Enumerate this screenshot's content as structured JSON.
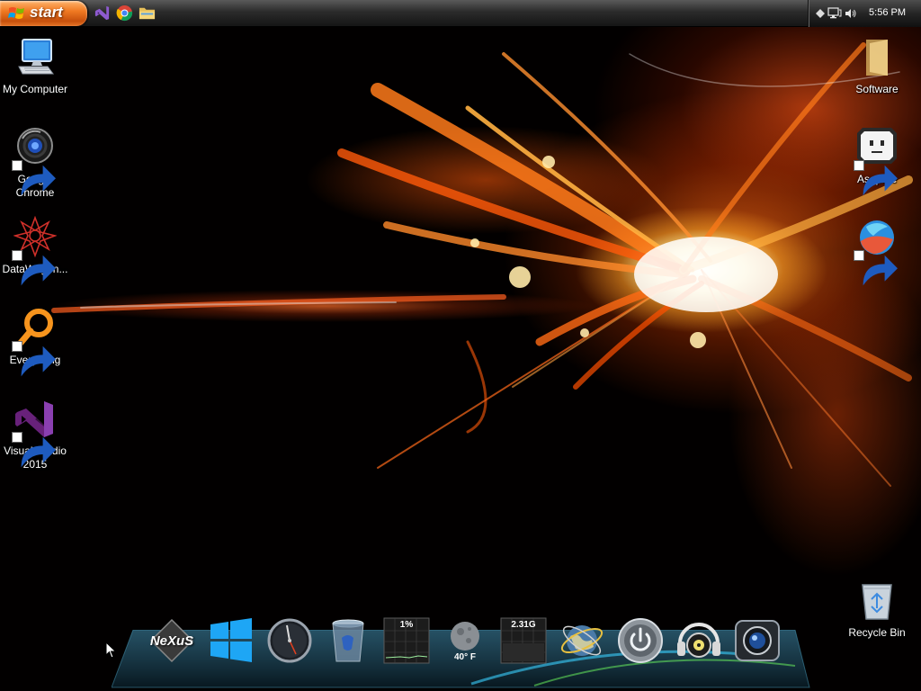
{
  "taskbar": {
    "start_label": "start",
    "quick_launch": [
      {
        "name": "visual-studio-icon"
      },
      {
        "name": "chrome-icon"
      },
      {
        "name": "folder-icon"
      }
    ],
    "tray": {
      "icons": [
        "show-hidden-icon",
        "network-icon",
        "volume-icon"
      ],
      "time": "5:56 PM"
    }
  },
  "desktop": {
    "left_icons": [
      {
        "label": "My Computer",
        "icon": "computer-icon",
        "shortcut": false
      },
      {
        "label": "Google Chrome",
        "icon": "chrome-icon",
        "shortcut": true
      },
      {
        "label": "DataWagon...",
        "icon": "datawagon-icon",
        "shortcut": true
      },
      {
        "label": "Everything",
        "icon": "everything-search-icon",
        "shortcut": true
      },
      {
        "label": "Visual Studio 2015",
        "icon": "visual-studio-icon",
        "shortcut": true
      }
    ],
    "right_icons": [
      {
        "label": "Software",
        "icon": "folder-icon",
        "shortcut": false
      },
      {
        "label": "Aseprite",
        "icon": "aseprite-icon",
        "shortcut": true
      },
      {
        "label": "",
        "icon": "browser-icon",
        "shortcut": true
      },
      {
        "label": "Recycle Bin",
        "icon": "recycle-bin-icon",
        "shortcut": false
      }
    ]
  },
  "dock": {
    "items": [
      {
        "name": "nexus-logo",
        "text": "NeXuS"
      },
      {
        "name": "windows-icon",
        "text": ""
      },
      {
        "name": "clock-widget",
        "text": ""
      },
      {
        "name": "recycle-bin-icon",
        "text": ""
      },
      {
        "name": "cpu-meter",
        "text": "1%"
      },
      {
        "name": "weather-widget",
        "text": "40° F"
      },
      {
        "name": "memory-meter",
        "text": "2.31G"
      },
      {
        "name": "network-globe-icon",
        "text": ""
      },
      {
        "name": "power-button",
        "text": ""
      },
      {
        "name": "music-player-icon",
        "text": ""
      },
      {
        "name": "camera-icon",
        "text": ""
      }
    ]
  },
  "colors": {
    "start_orange": "#f07a23",
    "taskbar_dark": "#1f1f1f",
    "vs_purple": "#68217a",
    "everything_orange": "#f7941d"
  }
}
